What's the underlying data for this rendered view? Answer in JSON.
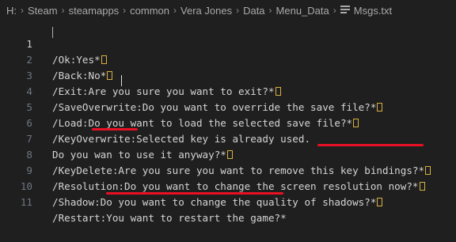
{
  "breadcrumb": {
    "items": [
      "H:",
      "Steam",
      "steamapps",
      "common",
      "Vera Jones",
      "Data",
      "Menu_Data"
    ],
    "file": "Msgs.txt"
  },
  "editor": {
    "active_line": 1,
    "lines": [
      {
        "num": "1",
        "text": "/Ok:Yes*"
      },
      {
        "num": "2",
        "text": "/Back:No*"
      },
      {
        "num": "3",
        "text": "/Exit:Are you sure you want to exit?*"
      },
      {
        "num": "4",
        "text": "/SaveOverwrite:Do you want to override the save file?*"
      },
      {
        "num": "5",
        "text": "/Load:Do you want to load the selected save file?*"
      },
      {
        "num": "6",
        "text": "/KeyOverwrite:Selected key is already used."
      },
      {
        "num": "7",
        "text": "Do you wan to use it anyway?*"
      },
      {
        "num": "8",
        "text": "/KeyDelete:Are you sure you want to remove this key bindings?*"
      },
      {
        "num": "9",
        "text": "/Resolution:Do you want to change the screen resolution now?*"
      },
      {
        "num": "10",
        "text": "/Shadow:Do you want to change the quality of shadows?*"
      },
      {
        "num": "11",
        "text": "/Restart:You want to restart the game?*"
      }
    ]
  },
  "colors": {
    "background": "#1f1f1f",
    "text": "#d4d4d4",
    "line_number": "#6e7681",
    "control_char_box": "#d8b040",
    "annotation_underline": "#e81123"
  },
  "icons": {
    "file": "text-file-icon",
    "control_char": "carriage-return-box-icon"
  }
}
